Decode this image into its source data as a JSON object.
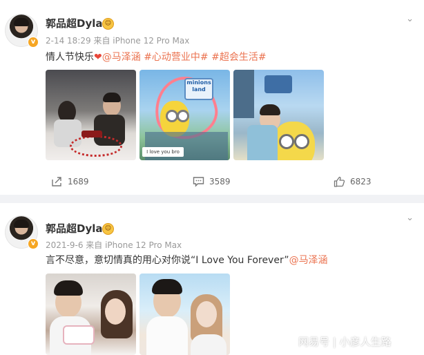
{
  "posts": [
    {
      "username": "郭品超Dylan",
      "meta": "2-14 18:29  来自 iPhone 12 Pro Max",
      "text_prefix": "情人节快乐",
      "mention": "@马泽涵",
      "tags": [
        "#心动营业中#",
        "#超会生活#"
      ],
      "img2_sign_line1": "minions",
      "img2_sign_line2": "land",
      "img2_caption": "I love you bro",
      "actions": {
        "repost": "1689",
        "comment": "3589",
        "like": "6823"
      }
    },
    {
      "username": "郭品超Dylan",
      "meta": "2021-9-6  来自 iPhone 12 Pro Max",
      "text": "言不尽意，意切情真的用心对你说“I Love You Forever”",
      "mention": "@马泽涵"
    }
  ],
  "watermark": "网易号 | 小彦人生路",
  "icons": {
    "repost": "repost-icon",
    "comment": "comment-icon",
    "like": "thumbs-up-icon",
    "more": "chevron-down-icon"
  }
}
